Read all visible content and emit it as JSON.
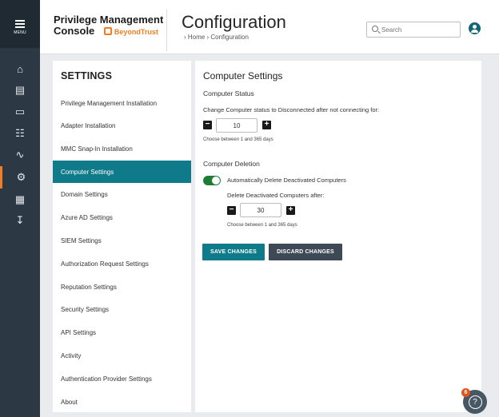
{
  "rail": {
    "menu_label": "MENU",
    "icons": [
      "home-icon",
      "user-list-icon",
      "computer-icon",
      "org-chart-icon",
      "analytics-icon",
      "gears-icon",
      "clipboard-icon",
      "download-tray-icon"
    ],
    "active_icon": "gears-icon"
  },
  "header": {
    "brand_line1": "Privilege Management",
    "brand_line2": "Console",
    "vendor": "BeyondTrust",
    "page_title": "Configuration",
    "breadcrumb": "› Home  › Configuration",
    "search_placeholder": "Search"
  },
  "settings": {
    "heading": "SETTINGS",
    "items": [
      {
        "label": "Privilege Management Installation",
        "active": false
      },
      {
        "label": "Adapter Installation",
        "active": false
      },
      {
        "label": "MMC Snap-In Installation",
        "active": false
      },
      {
        "label": "Computer Settings",
        "active": true
      },
      {
        "label": "Domain Settings",
        "active": false
      },
      {
        "label": "Azure AD Settings",
        "active": false
      },
      {
        "label": "SIEM Settings",
        "active": false
      },
      {
        "label": "Authorization Request Settings",
        "active": false
      },
      {
        "label": "Reputation Settings",
        "active": false
      },
      {
        "label": "Security Settings",
        "active": false
      },
      {
        "label": "API Settings",
        "active": false
      },
      {
        "label": "Activity",
        "active": false
      },
      {
        "label": "Authentication Provider Settings",
        "active": false
      },
      {
        "label": "About",
        "active": false
      }
    ]
  },
  "main": {
    "title": "Computer Settings",
    "status_section": "Computer Status",
    "status_text": "Change Computer status to Disconnected after not connecting for:",
    "status_days": "10",
    "status_hint": "Choose between 1 and 365 days",
    "deletion_section": "Computer Deletion",
    "auto_delete_label": "Automatically Delete Deactivated Computers",
    "auto_delete_on": true,
    "delete_after_text": "Delete Deactivated Computers after:",
    "delete_days": "30",
    "delete_hint": "Choose between 1 and 365 days",
    "save_label": "SAVE CHANGES",
    "discard_label": "DISCARD CHANGES"
  },
  "help": {
    "badge_count": "6"
  },
  "colors": {
    "accent": "#0f7a8a",
    "rail": "#2c3945",
    "toggle_on": "#1e7d33",
    "badge": "#e2541b",
    "brand_orange": "#f07d22"
  }
}
